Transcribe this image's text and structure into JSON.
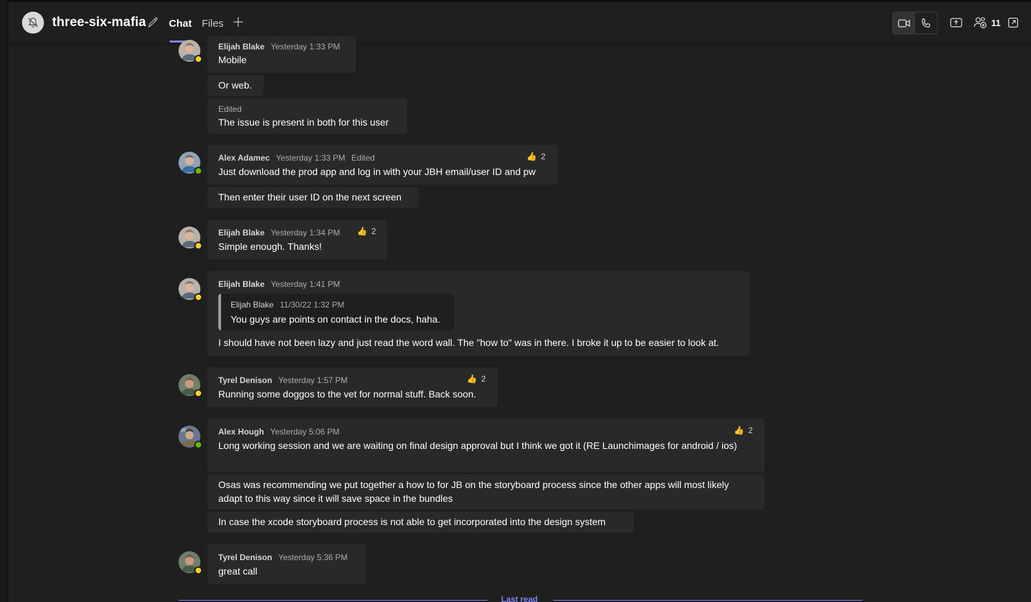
{
  "header": {
    "title": "three-six-mafia",
    "tabs": [
      {
        "label": "Chat",
        "active": true
      },
      {
        "label": "Files",
        "active": false
      }
    ],
    "participant_count": "11",
    "accent_color": "#7f85f5"
  },
  "messages": [
    {
      "author": "Elijah Blake",
      "time": "Yesterday 1:33 PM",
      "text": "Mobile",
      "presence": "away"
    },
    {
      "text": "Or web."
    },
    {
      "edited_label": "Edited",
      "text": "The issue is present in both for this user"
    },
    {
      "author": "Alex Adamec",
      "time": "Yesterday 1:33 PM",
      "edited": "Edited",
      "text": "Just download the prod app and log in with your JBH email/user ID and pw",
      "reaction": {
        "emoji": "👍",
        "count": "2"
      },
      "presence": "online"
    },
    {
      "text": "Then enter their user ID on the next screen"
    },
    {
      "author": "Elijah Blake",
      "time": "Yesterday 1:34 PM",
      "text": "Simple enough. Thanks!",
      "reaction": {
        "emoji": "👍",
        "count": "2"
      },
      "presence": "away"
    },
    {
      "author": "Elijah Blake",
      "time": "Yesterday 1:41 PM",
      "quote": {
        "author": "Elijah Blake",
        "time": "11/30/22 1:32 PM",
        "text": "You guys are points on contact in the docs, haha."
      },
      "text": "I should have not been lazy and just read the word wall. The \"how to\" was in there. I broke it up to be easier to look at.",
      "presence": "away"
    },
    {
      "author": "Tyrel Denison",
      "time": "Yesterday 1:57 PM",
      "text": "Running some doggos to the vet for normal stuff. Back soon.",
      "reaction": {
        "emoji": "👍",
        "count": "2"
      },
      "presence": "away"
    },
    {
      "author": "Alex Hough",
      "time": "Yesterday 5:06 PM",
      "text": "Long working session and we are waiting on final design approval but I think we got it (RE Launchimages for android / ios)",
      "reaction": {
        "emoji": "👍",
        "count": "2"
      },
      "presence": "online"
    },
    {
      "text": "Osas was recommending we put together a how to for JB on the storyboard process since the other apps will most likely adapt to this way since it will save space in the bundles"
    },
    {
      "text": "In case the xcode storyboard process is not able to get incorporated into the design system"
    },
    {
      "author": "Tyrel Denison",
      "time": "Yesterday 5:36 PM",
      "text": "great call",
      "presence": "away"
    }
  ],
  "last_read_label": "Last read"
}
